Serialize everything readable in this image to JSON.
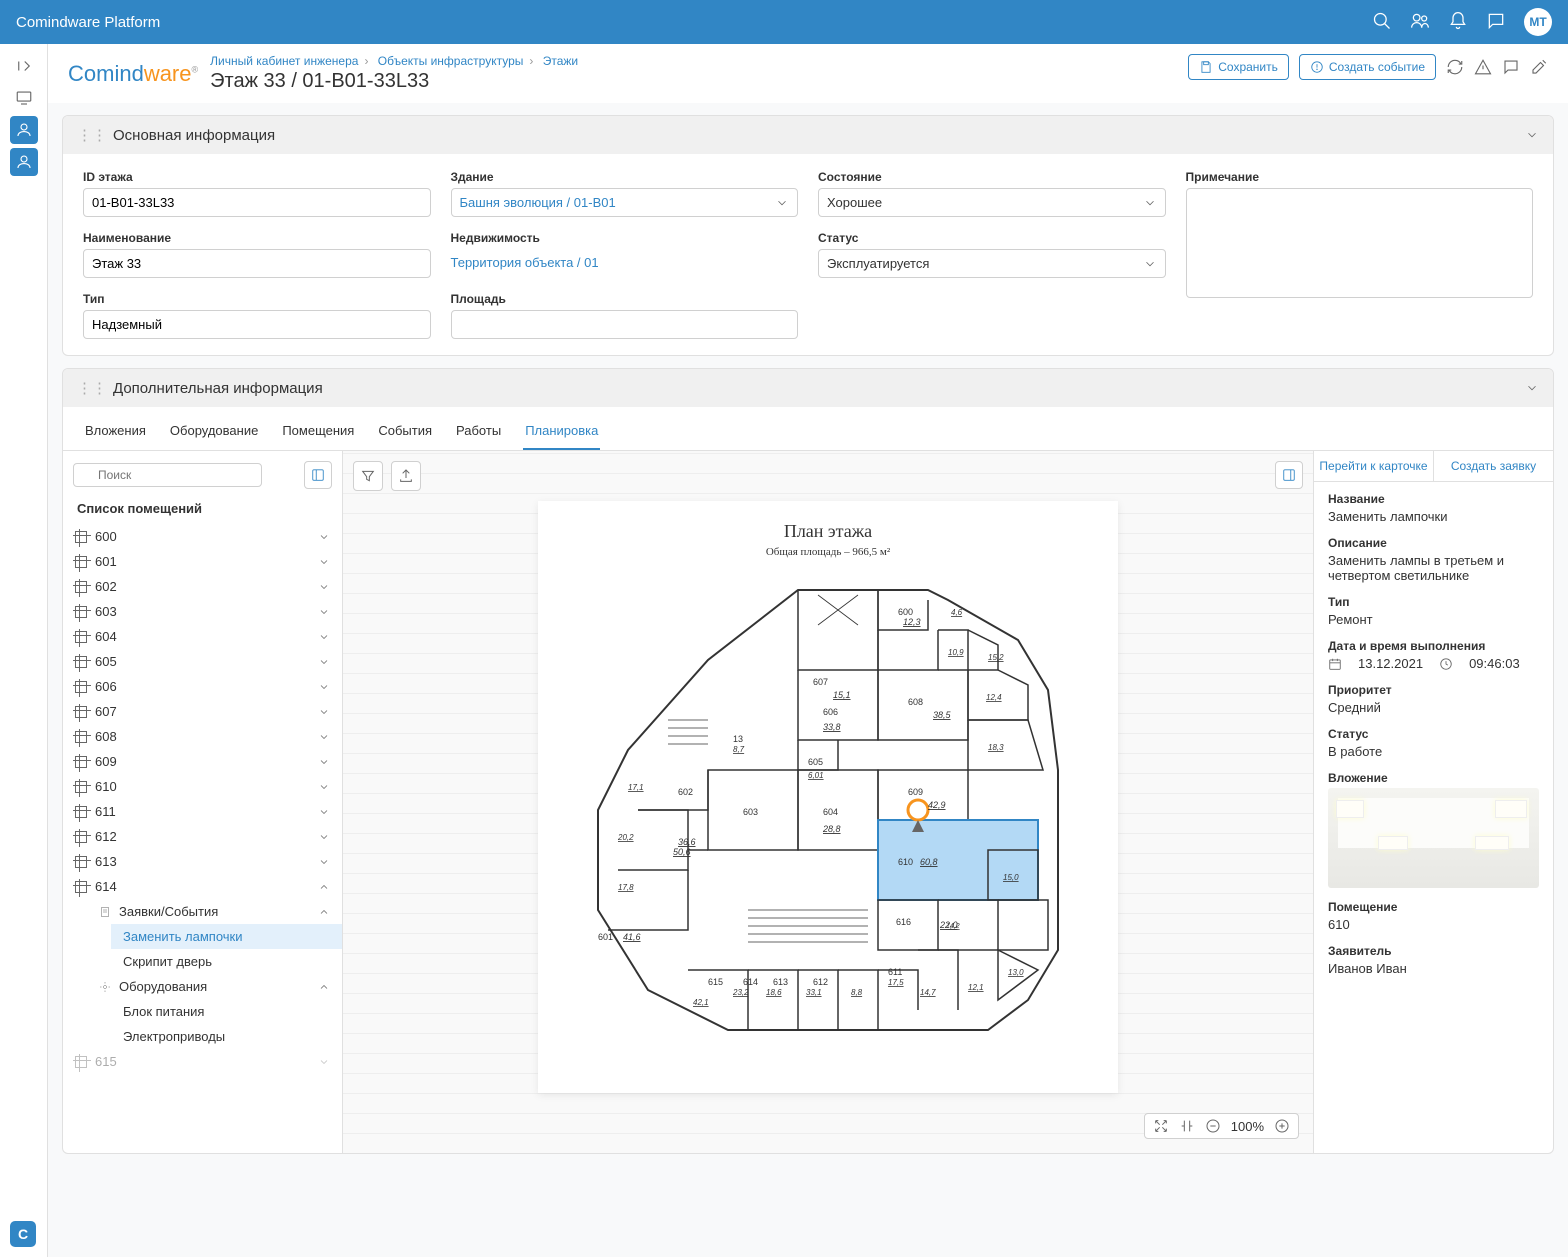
{
  "topbar": {
    "title": "Comindware Platform",
    "avatar": "MT"
  },
  "breadcrumb": [
    "Личный кабинет инженера",
    "Объекты инфраструктуры",
    "Этажи"
  ],
  "pageTitle": "Этаж 33 / 01-B01-33L33",
  "toolbar": {
    "save": "Сохранить",
    "createEvent": "Создать событие"
  },
  "section1": {
    "title": "Основная информация",
    "fields": {
      "idLabel": "ID этажа",
      "idValue": "01-B01-33L33",
      "buildingLabel": "Здание",
      "buildingValue": "Башня эволюция / 01-B01",
      "conditionLabel": "Состояние",
      "conditionValue": "Хорошее",
      "noteLabel": "Примечание",
      "nameLabel": "Наименование",
      "nameValue": "Этаж 33",
      "realestateLabel": "Недвижимость",
      "realestateValue": "Территория объекта / 01",
      "statusLabel": "Статус",
      "statusValue": "Эксплуатируется",
      "typeLabel": "Тип",
      "typeValue": "Надземный",
      "areaLabel": "Площадь"
    }
  },
  "section2": {
    "title": "Дополнительная информация",
    "tabs": [
      "Вложения",
      "Оборудование",
      "Помещения",
      "События",
      "Работы",
      "Планировка"
    ],
    "activeTab": 5,
    "searchPlaceholder": "Поиск",
    "treeTitle": "Список помещений",
    "rooms": [
      "600",
      "601",
      "602",
      "603",
      "604",
      "605",
      "606",
      "607",
      "608",
      "609",
      "610",
      "611",
      "612",
      "613",
      "614"
    ],
    "room614": {
      "label": "614",
      "requests": {
        "label": "Заявки/События",
        "items": [
          "Заменить лампочки",
          "Скрипит дверь"
        ]
      },
      "equipment": {
        "label": "Оборудования",
        "items": [
          "Блок питания",
          "Электроприводы"
        ]
      }
    },
    "lastRoom": "615"
  },
  "plan": {
    "title": "План этажа",
    "subtitle": "Общая площадь – 966,5 м²"
  },
  "zoom": "100%",
  "detail": {
    "goToCard": "Перейти к карточке",
    "createRequest": "Создать заявку",
    "titleLabel": "Название",
    "titleValue": "Заменить лампочки",
    "descLabel": "Описание",
    "descValue": "Заменить лампы в третьем и четвертом светильнике",
    "typeLabel": "Тип",
    "typeValue": "Ремонт",
    "dtLabel": "Дата и время выполнения",
    "date": "13.12.2021",
    "time": "09:46:03",
    "priorityLabel": "Приоритет",
    "priorityValue": "Средний",
    "statusLabel": "Статус",
    "statusValue": "В работе",
    "attachLabel": "Вложение",
    "roomLabel": "Помещение",
    "roomValue": "610",
    "requesterLabel": "Заявитель",
    "requesterValue": "Иванов Иван"
  },
  "floorRooms": [
    {
      "n": "601",
      "a": "41,6"
    },
    {
      "n": "602",
      "a": "50,6"
    },
    {
      "n": "603",
      "a": "36,6"
    },
    {
      "n": "604",
      "a": "28,8"
    },
    {
      "n": "605",
      "a": "6,01"
    },
    {
      "n": "606",
      "a": "33,8"
    },
    {
      "n": "607",
      "a": "15,1"
    },
    {
      "n": "608",
      "a": "38,5"
    },
    {
      "n": "609",
      "a": "42,9"
    },
    {
      "n": "610",
      "a": "60,8"
    },
    {
      "n": "611",
      "a": "17,5"
    },
    {
      "n": "612",
      "a": ""
    },
    {
      "n": "613",
      "a": ""
    },
    {
      "n": "614",
      "a": ""
    },
    {
      "n": "615",
      "a": ""
    },
    {
      "n": "616",
      "a": "22,0"
    },
    {
      "n": "600",
      "a": "12,3"
    }
  ],
  "extraAreas": [
    "4,6",
    "10,9",
    "15,2",
    "12,4",
    "18,3",
    "15,0",
    "14,2",
    "13,0",
    "12,1",
    "14,7",
    "8,8",
    "33,1",
    "18,6",
    "23,2",
    "42,1",
    "17,8",
    "20,2",
    "17,1",
    "13",
    "8,7"
  ]
}
